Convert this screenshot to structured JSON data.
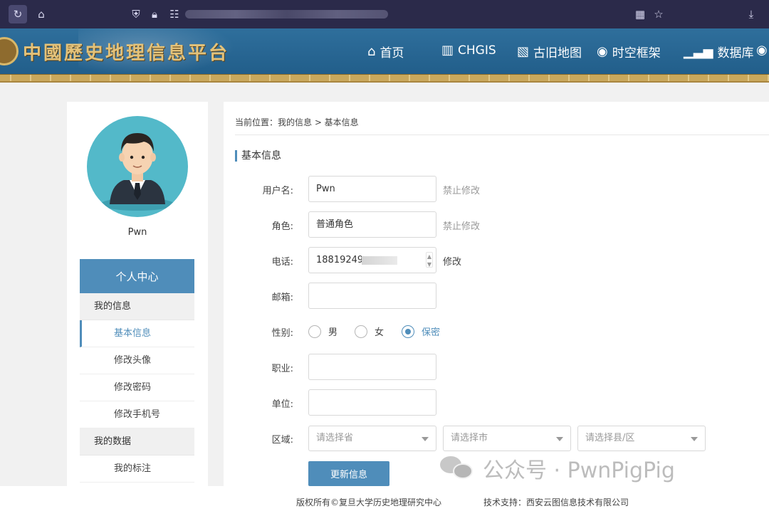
{
  "site": {
    "title": "中國歷史地理信息平台",
    "nav": [
      {
        "label": "首页",
        "icon": "home-icon"
      },
      {
        "label": "CHGIS",
        "icon": "map-icon"
      },
      {
        "label": "古旧地图",
        "icon": "folded-map-icon"
      },
      {
        "label": "时空框架",
        "icon": "location-map-icon"
      },
      {
        "label": "数据库",
        "icon": "bar-chart-icon"
      }
    ]
  },
  "sidebar": {
    "username": "Pwn",
    "center_title": "个人中心",
    "groups": [
      {
        "label": "我的信息",
        "items": [
          "基本信息",
          "修改头像",
          "修改密码",
          "修改手机号"
        ]
      },
      {
        "label": "我的数据",
        "items": [
          "我的标注"
        ]
      }
    ],
    "active_item": "基本信息"
  },
  "main": {
    "breadcrumb": "当前位置：我的信息 > 基本信息",
    "section_title": "基本信息",
    "form": {
      "username": {
        "label": "用户名:",
        "value": "Pwn",
        "hint": "禁止修改"
      },
      "role": {
        "label": "角色:",
        "value": "普通角色",
        "hint": "禁止修改"
      },
      "phone": {
        "label": "电话:",
        "value": "18819249",
        "hint": "修改"
      },
      "email": {
        "label": "邮箱:",
        "value": ""
      },
      "gender": {
        "label": "性别:",
        "options": [
          "男",
          "女",
          "保密"
        ],
        "selected": "保密"
      },
      "occupation": {
        "label": "职业:",
        "value": ""
      },
      "unit": {
        "label": "单位:",
        "value": ""
      },
      "region": {
        "label": "区域:",
        "province_placeholder": "请选择省",
        "city_placeholder": "请选择市",
        "county_placeholder": "请选择县/区"
      }
    },
    "submit_label": "更新信息"
  },
  "watermark": "公众号 · PwnPigPig",
  "footer": {
    "copyright": "版权所有©复旦大学历史地理研究中心",
    "tech_support": "技术支持：西安云图信息技术有限公司"
  },
  "colors": {
    "accent": "#4f8dba",
    "header_bg": "#1f5b87",
    "browser_bg": "#2b2a4a"
  }
}
